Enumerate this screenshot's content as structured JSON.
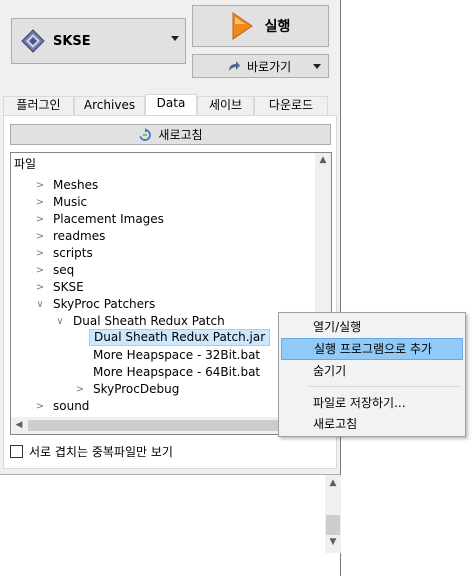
{
  "toolbar": {
    "profile_label": "SKSE",
    "run_label": "실행",
    "shortcut_label": "바로가기"
  },
  "tabs": [
    {
      "label": "플러그인"
    },
    {
      "label": "Archives"
    },
    {
      "label": "Data"
    },
    {
      "label": "세이브"
    },
    {
      "label": "다운로드"
    }
  ],
  "data_tab": {
    "refresh_label": "새로고침",
    "tree_header": "파일",
    "filter_checkbox_label": "서로 겹치는 중복파일만 보기"
  },
  "tree": [
    {
      "label": "Meshes"
    },
    {
      "label": "Music"
    },
    {
      "label": "Placement Images"
    },
    {
      "label": "readmes"
    },
    {
      "label": "scripts"
    },
    {
      "label": "seq"
    },
    {
      "label": "SKSE"
    },
    {
      "label": "SkyProc Patchers"
    },
    {
      "label": "Dual Sheath Redux Patch"
    },
    {
      "label": "Dual Sheath Redux Patch.jar"
    },
    {
      "label": "More Heapspace - 32Bit.bat"
    },
    {
      "label": "More Heapspace - 64Bit.bat"
    },
    {
      "label": "SkyProcDebug"
    },
    {
      "label": "sound"
    }
  ],
  "context_menu": [
    {
      "label": "열기/실행"
    },
    {
      "label": "실행 프로그램으로 추가"
    },
    {
      "label": "숨기기"
    },
    {
      "label": "파일로 저장하기..."
    },
    {
      "label": "새로고침"
    }
  ],
  "colors": {
    "selection": "#cce8ff",
    "menu_highlight": "#91c9f7",
    "run_icon": "#f08a1c"
  },
  "icons": {
    "profile": "skse-diamond-icon",
    "run": "play-triangle-icon",
    "shortcut": "shortcut-arrow-icon",
    "refresh": "refresh-icon"
  }
}
